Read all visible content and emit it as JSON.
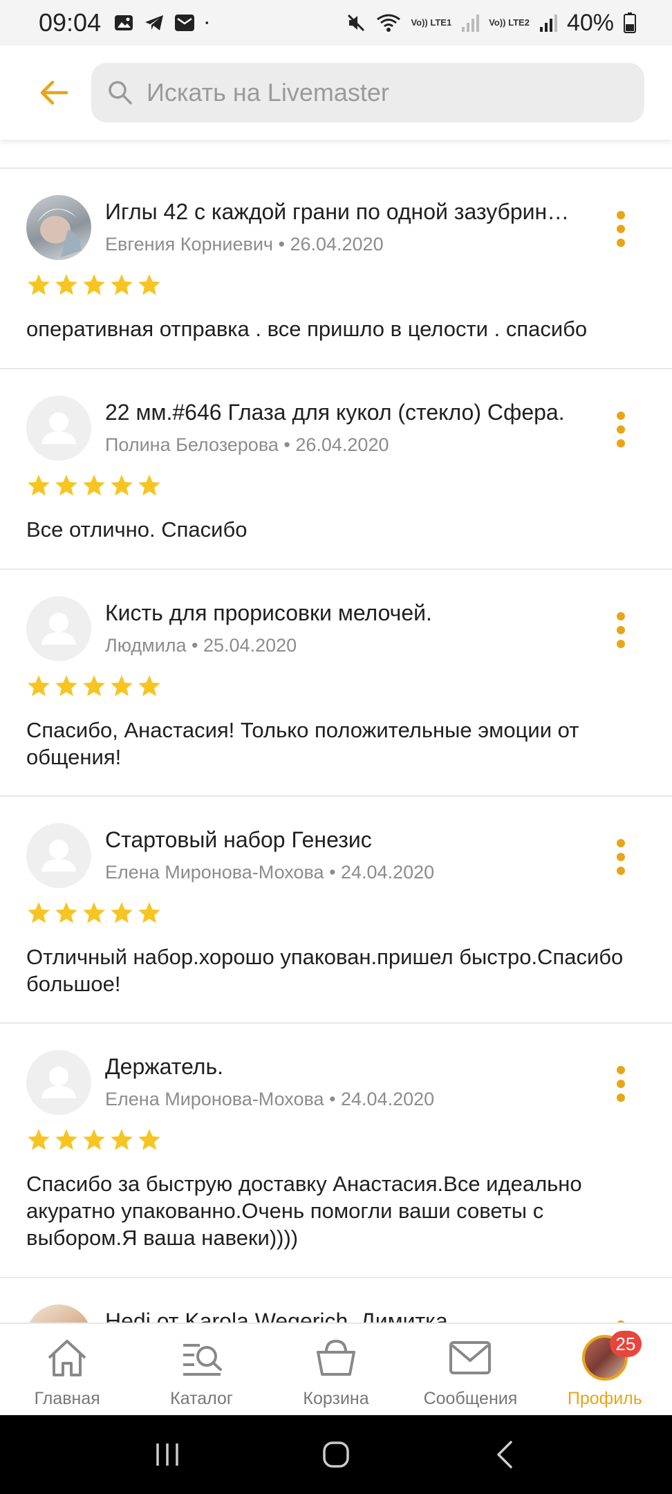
{
  "status_bar": {
    "time": "09:04",
    "battery": "40%",
    "sim1": "Vo)) LTE1",
    "sim2": "Vo)) LTE2"
  },
  "header": {
    "search_placeholder": "Искать на Livemaster"
  },
  "reviews": [
    {
      "title": "Иглы 42 с каждой грани по одной зазубрин…",
      "author": "Евгения Корниевич",
      "date": "26.04.2020",
      "meta": "Евгения Корниевич • 26.04.2020",
      "rating": 5,
      "text": "оперативная отправка . все пришло в целости . спасибо"
    },
    {
      "title": "22 мм.#646  Глаза для кукол (стекло) Сфера.",
      "author": "Полина Белозерова",
      "date": "26.04.2020",
      "meta": "Полина Белозерова • 26.04.2020",
      "rating": 5,
      "text": "Все отлично. Спасибо"
    },
    {
      "title": "Кисть для прорисовки мелочей.",
      "author": "Людмила",
      "date": "25.04.2020",
      "meta": "Людмила • 25.04.2020",
      "rating": 5,
      "text": "Спасибо, Анастасия! Только положительные эмоции от общения!"
    },
    {
      "title": "Стартовый набор Генезис",
      "author": "Елена Миронова-Мохова",
      "date": "24.04.2020",
      "meta": "Елена Миронова-Мохова • 24.04.2020",
      "rating": 5,
      "text": "Отличный набор.хорошо упакован.пришел быстро.Спасибо большое!"
    },
    {
      "title": "Держатель.",
      "author": "Елена Миронова-Мохова",
      "date": "24.04.2020",
      "meta": "Елена Миронова-Мохова • 24.04.2020",
      "rating": 5,
      "text": "Спасибо за быструю доставку Анастасия.Все идеально акуратно упакованно.Очень помогли ваши советы с выбором.Я ваша навеки))))"
    },
    {
      "title": "Hedi от Karola Wegerich. Димитка"
    }
  ],
  "bottom_nav": {
    "items": [
      {
        "label": "Главная",
        "icon": "home-icon"
      },
      {
        "label": "Каталог",
        "icon": "catalog-icon"
      },
      {
        "label": "Корзина",
        "icon": "basket-icon"
      },
      {
        "label": "Сообщения",
        "icon": "mail-icon"
      },
      {
        "label": "Профиль",
        "icon": "profile-avatar",
        "badge": "25",
        "active": true
      }
    ]
  },
  "colors": {
    "accent": "#e8a516",
    "star": "#f7c522",
    "badge": "#e8453c"
  }
}
